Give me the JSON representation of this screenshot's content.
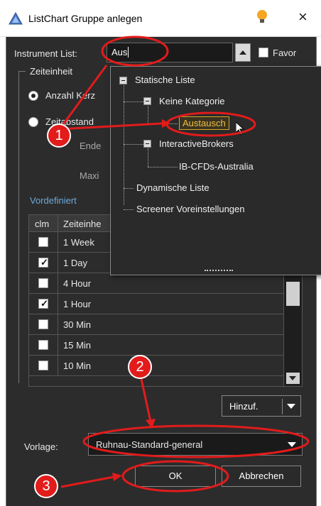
{
  "window": {
    "title": "ListChart Gruppe anlegen",
    "close_glyph": "×",
    "icons": {
      "app": "triangle-app-icon",
      "hint": "lightbulb-icon",
      "close": "close-icon"
    }
  },
  "instrument": {
    "label": "Instrument List:",
    "value": "Aus",
    "favor_label": "Favor",
    "favor_checked": false
  },
  "zeiteinheit": {
    "group_label": "Zeiteinheit",
    "radio_1": "Anzahl Kerz",
    "radio_2": "Zeitabstand",
    "ende_label": "Ende",
    "maxi_label": "Maxi"
  },
  "vordefiniert": {
    "label": "Vordefiniert",
    "headers": {
      "clm": "clm",
      "zeit": "Zeiteinhe"
    },
    "rows": [
      {
        "label": "1 Week",
        "checked": false
      },
      {
        "label": "1 Day",
        "checked": true
      },
      {
        "label": "4 Hour",
        "checked": false
      },
      {
        "label": "1 Hour",
        "checked": true
      },
      {
        "label": "30 Min",
        "checked": false
      },
      {
        "label": "15 Min",
        "checked": false
      },
      {
        "label": "10 Min",
        "checked": false
      }
    ],
    "check_glyph": "✓"
  },
  "add_button": {
    "label": "Hinzuf."
  },
  "vorlage": {
    "label": "Vorlage:",
    "value": "Ruhnau-Standard-general"
  },
  "footer": {
    "ok": "OK",
    "cancel": "Abbrechen"
  },
  "tree": {
    "static": "Statische Liste",
    "no_category": "Keine Kategorie",
    "selected": "Austausch",
    "broker": "InteractiveBrokers",
    "cfd": "IB-CFDs-Australia",
    "dynamic": "Dynamische Liste",
    "screener": "Screener Voreinstellungen"
  },
  "annotations": {
    "badge_1": "1",
    "badge_2": "2",
    "badge_3": "3",
    "color": "#e21b1b"
  }
}
